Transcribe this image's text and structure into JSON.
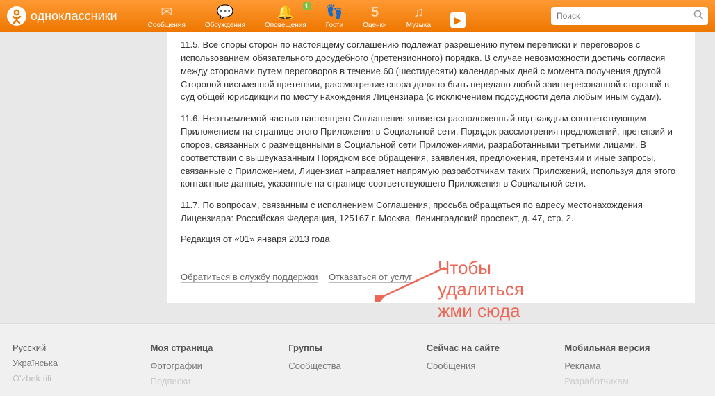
{
  "header": {
    "logo_text": "одноклассники",
    "search_placeholder": "Поиск"
  },
  "nav": {
    "items": [
      {
        "label": "Сообщения",
        "glyph": "✉"
      },
      {
        "label": "Обсуждения",
        "glyph": "💬"
      },
      {
        "label": "Оповещения",
        "glyph": "🔔",
        "badge": "1"
      },
      {
        "label": "Гости",
        "glyph": "👣"
      },
      {
        "label": "Оценки",
        "glyph": "5"
      },
      {
        "label": "Музыка",
        "glyph": "♫"
      },
      {
        "label": "",
        "glyph": "▶"
      }
    ]
  },
  "content": {
    "p115": "11.5. Все споры сторон по настоящему соглашению подлежат разрешению путем переписки и переговоров с использованием обязательного досудебного (претензионного) порядка. В случае невозможности достичь согласия между сторонами путем переговоров в течение 60 (шестидесяти) календарных дней с момента получения другой Стороной письменной претензии, рассмотрение спора должно быть передано любой заинтересованной стороной в суд общей юрисдикции по месту нахождения Лицензиара (с исключением подсудности дела любым иным судам).",
    "p116": "11.6. Неотъемлемой частью настоящего Соглашения является расположенный под каждым соответствующим Приложением на странице этого Приложения в Социальной сети. Порядок рассмотрения предложений, претензий и споров, связанных с размещенными в Социальной сети Приложениями, разработанными третьими лицами. В соответствии с вышеуказанным Порядком все обращения, заявления, предложения, претензии и иные запросы, связанные с Приложением, Лицензиат направляет напрямую разработчикам таких Приложений, используя для этого контактные данные, указанные на странице соответствующего Приложения в Социальной сети.",
    "p117": "11.7. По вопросам, связанным с исполнением Соглашения, просьба обращаться по адресу местонахождения Лицензиара: Российская Федерация, 125167 г. Москва, Ленинградский проспект, д. 47, стр. 2.",
    "revision": "Редакция от «01» января 2013 года",
    "support_link": "Обратиться в службу поддержки",
    "decline_link": "Отказаться от услуг"
  },
  "annotation": {
    "line1": "Чтобы",
    "line2": "удалиться",
    "line3": "жми сюда"
  },
  "footer": {
    "langs": {
      "ru": "Русский",
      "ua": "Українська",
      "uz": "O'zbek tili"
    },
    "col2_head": "Моя страница",
    "col2_a": "Фотографии",
    "col2_b": "Подписки",
    "col3_head": "Группы",
    "col3_a": "Сообщества",
    "col4_head": "Сейчас на сайте",
    "col4_a": "Сообщения",
    "col5_head": "Мобильная версия",
    "col5_a": "Реклама",
    "col5_b": "Разработчикам"
  }
}
